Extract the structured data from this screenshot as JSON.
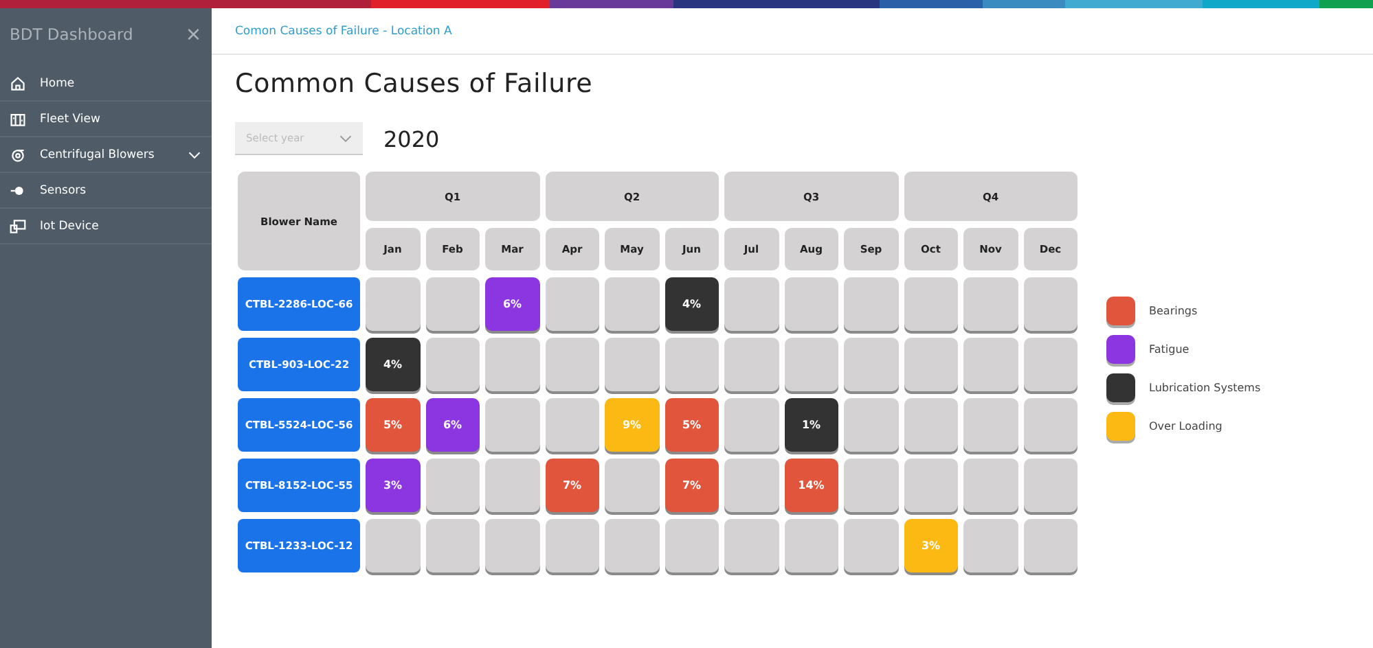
{
  "sidebar": {
    "title": "BDT Dashboard",
    "close": "×",
    "items": [
      {
        "label": "Home",
        "expandable": false
      },
      {
        "label": "Fleet View",
        "expandable": false
      },
      {
        "label": "Centrifugal Blowers",
        "expandable": true
      },
      {
        "label": "Sensors",
        "expandable": false
      },
      {
        "label": "Iot Device",
        "expandable": false
      }
    ]
  },
  "breadcrumb": "Comon Causes of Failure - Location A",
  "title": "Common Causes of Failure",
  "year_select": {
    "placeholder": "Select year"
  },
  "year": "2020",
  "table": {
    "name_header": "Blower Name",
    "quarters": [
      "Q1",
      "Q2",
      "Q3",
      "Q4"
    ],
    "months": [
      "Jan",
      "Feb",
      "Mar",
      "Apr",
      "May",
      "Jun",
      "Jul",
      "Aug",
      "Sep",
      "Oct",
      "Nov",
      "Dec"
    ],
    "rows": [
      {
        "name": "CTBL-2286-LOC-66",
        "cells": [
          {
            "kind": "empty"
          },
          {
            "kind": "empty"
          },
          {
            "kind": "value",
            "value": "6%",
            "color": "#8b36e0"
          },
          {
            "kind": "empty"
          },
          {
            "kind": "empty"
          },
          {
            "kind": "value",
            "value": "4%",
            "color": "#333333"
          },
          {
            "kind": "empty"
          },
          {
            "kind": "empty"
          },
          {
            "kind": "empty"
          },
          {
            "kind": "empty"
          },
          {
            "kind": "empty"
          },
          {
            "kind": "empty"
          }
        ]
      },
      {
        "name": "CTBL-903-LOC-22",
        "cells": [
          {
            "kind": "value",
            "value": "4%",
            "color": "#333333"
          },
          {
            "kind": "empty"
          },
          {
            "kind": "empty"
          },
          {
            "kind": "empty"
          },
          {
            "kind": "empty"
          },
          {
            "kind": "empty"
          },
          {
            "kind": "empty"
          },
          {
            "kind": "empty"
          },
          {
            "kind": "empty"
          },
          {
            "kind": "empty"
          },
          {
            "kind": "empty"
          },
          {
            "kind": "empty"
          }
        ]
      },
      {
        "name": "CTBL-5524-LOC-56",
        "cells": [
          {
            "kind": "value",
            "value": "5%",
            "color": "#e0553b"
          },
          {
            "kind": "value",
            "value": "6%",
            "color": "#8b36e0"
          },
          {
            "kind": "empty"
          },
          {
            "kind": "empty"
          },
          {
            "kind": "value",
            "value": "9%",
            "color": "#fdb913"
          },
          {
            "kind": "value",
            "value": "5%",
            "color": "#e0553b"
          },
          {
            "kind": "empty"
          },
          {
            "kind": "value",
            "value": "1%",
            "color": "#333333"
          },
          {
            "kind": "empty"
          },
          {
            "kind": "empty"
          },
          {
            "kind": "empty"
          },
          {
            "kind": "empty"
          }
        ]
      },
      {
        "name": "CTBL-8152-LOC-55",
        "cells": [
          {
            "kind": "value",
            "value": "3%",
            "color": "#8b36e0"
          },
          {
            "kind": "empty"
          },
          {
            "kind": "empty"
          },
          {
            "kind": "value",
            "value": "7%",
            "color": "#e0553b"
          },
          {
            "kind": "empty"
          },
          {
            "kind": "value",
            "value": "7%",
            "color": "#e0553b"
          },
          {
            "kind": "empty"
          },
          {
            "kind": "value",
            "value": "14%",
            "color": "#e0553b"
          },
          {
            "kind": "empty"
          },
          {
            "kind": "empty"
          },
          {
            "kind": "empty"
          },
          {
            "kind": "empty"
          }
        ]
      },
      {
        "name": "CTBL-1233-LOC-12",
        "cells": [
          {
            "kind": "empty"
          },
          {
            "kind": "empty"
          },
          {
            "kind": "empty"
          },
          {
            "kind": "empty"
          },
          {
            "kind": "empty"
          },
          {
            "kind": "empty"
          },
          {
            "kind": "empty"
          },
          {
            "kind": "empty"
          },
          {
            "kind": "empty"
          },
          {
            "kind": "value",
            "value": "3%",
            "color": "#fdb913"
          },
          {
            "kind": "empty"
          },
          {
            "kind": "empty"
          }
        ]
      }
    ]
  },
  "legend": [
    {
      "label": "Bearings",
      "color": "#e0553b"
    },
    {
      "label": "Fatigue",
      "color": "#8b36e0"
    },
    {
      "label": "Lubrication Systems",
      "color": "#333333"
    },
    {
      "label": "Over Loading",
      "color": "#fdb913"
    }
  ]
}
